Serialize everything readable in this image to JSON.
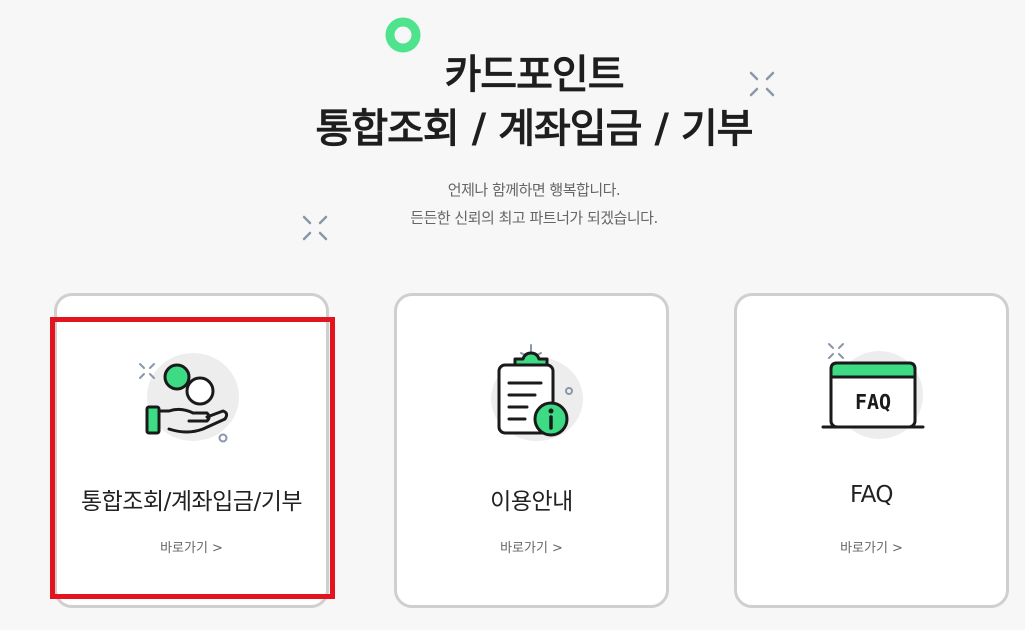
{
  "hero": {
    "title_line1": "카드포인트",
    "title_line2": "통합조회 / 계좌입금 / 기부",
    "subtitle_line1": "언제나 함께하면 행복합니다.",
    "subtitle_line2": "든든한 신뢰의 최고 파트너가 되겠습니다."
  },
  "cards": [
    {
      "title": "통합조회/계좌입금/기부",
      "link": "바로가기 >",
      "icon": "coins-hand-icon"
    },
    {
      "title": "이용안내",
      "link": "바로가기 >",
      "icon": "clipboard-info-icon"
    },
    {
      "title": "FAQ",
      "link": "바로가기 >",
      "icon": "faq-window-icon",
      "icon_text": "FAQ"
    }
  ],
  "colors": {
    "accent_green": "#3ddc84",
    "icon_dark": "#1a1a1a",
    "highlight_red": "#e3141d",
    "card_border": "#cfcfcf"
  }
}
